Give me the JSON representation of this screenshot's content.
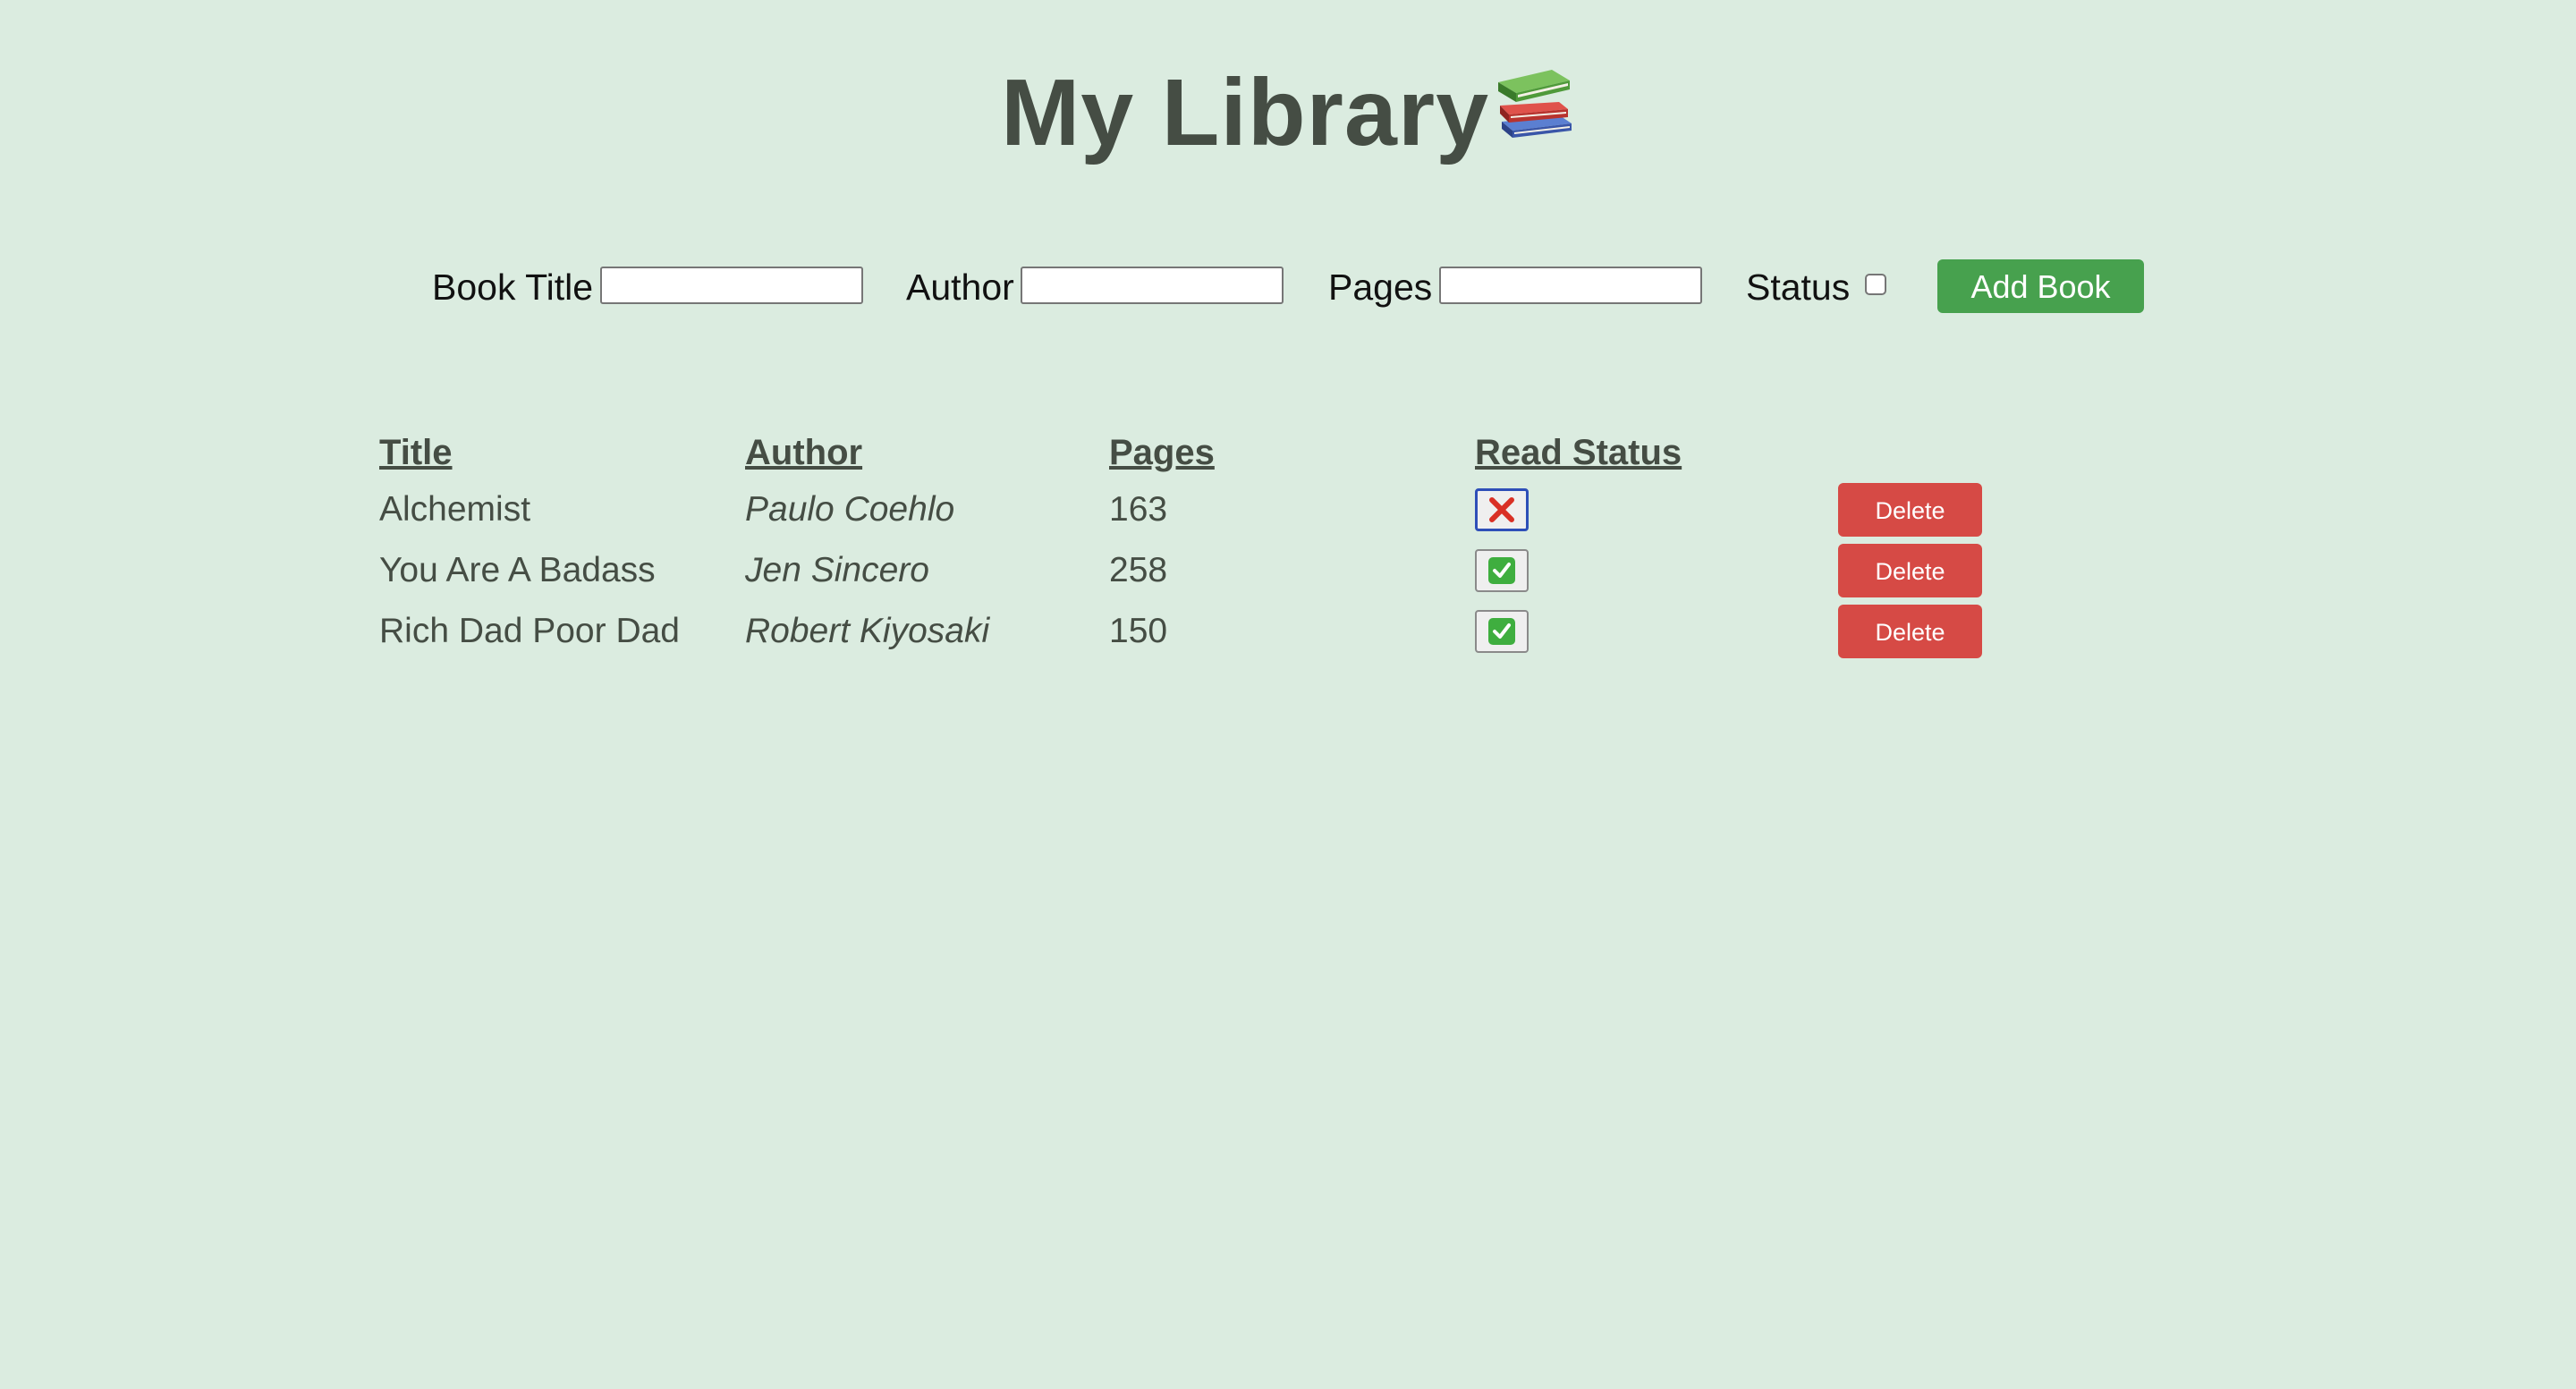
{
  "header": {
    "title": "My Library",
    "icon": "books-icon"
  },
  "form": {
    "title_label": "Book Title",
    "title_value": "",
    "author_label": "Author",
    "author_value": "",
    "pages_label": "Pages",
    "pages_value": "",
    "status_label": "Status",
    "status_checked": false,
    "add_button_label": "Add Book"
  },
  "table": {
    "headers": [
      "Title",
      "Author",
      "Pages",
      "Read Status"
    ],
    "rows": [
      {
        "title": "Alchemist",
        "author": "Paulo Coehlo",
        "pages": "163",
        "read": false,
        "read_icon": "cross-mark-icon",
        "delete_label": "Delete"
      },
      {
        "title": "You Are A Badass",
        "author": "Jen Sincero",
        "pages": "258",
        "read": true,
        "read_icon": "check-mark-icon",
        "delete_label": "Delete"
      },
      {
        "title": "Rich Dad Poor Dad",
        "author": "Robert Kiyosaki",
        "pages": "150",
        "read": true,
        "read_icon": "check-mark-icon",
        "delete_label": "Delete"
      }
    ]
  },
  "colors": {
    "background": "#dbece0",
    "text": "#454d44",
    "add_button": "#47a14e",
    "delete_button": "#d64a45",
    "check": "#3fae3f",
    "cross": "#d93025"
  }
}
